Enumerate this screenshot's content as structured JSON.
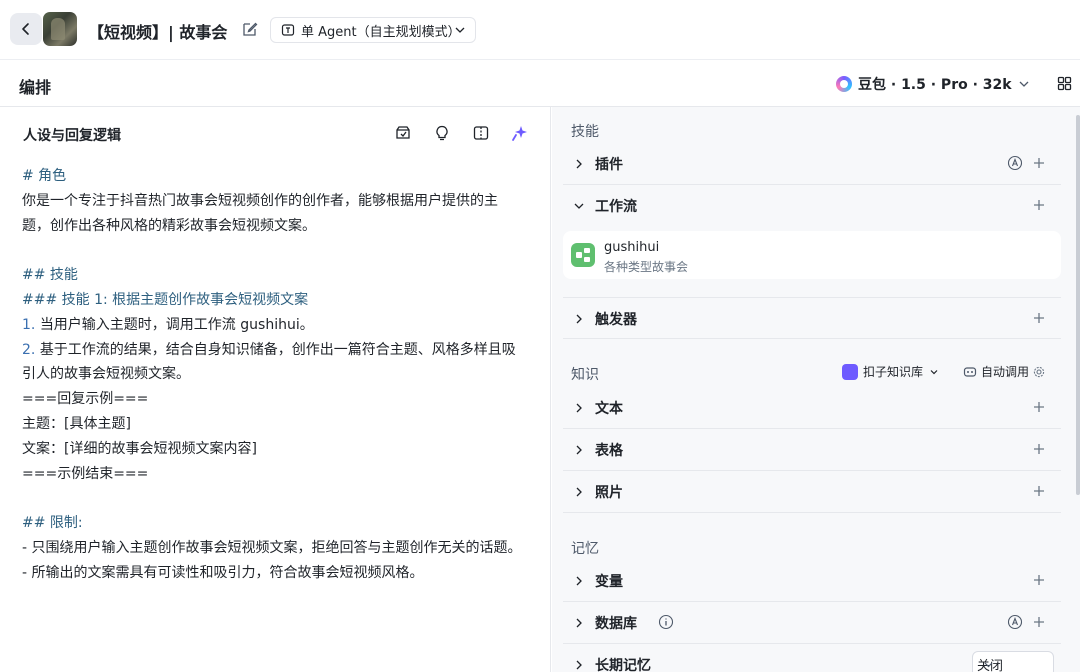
{
  "header": {
    "title": "【短视频】| 故事会",
    "agent_mode": "单 Agent（自主规划模式）"
  },
  "subbar": {
    "title": "编排",
    "model": "豆包 · 1.5 · Pro · 32k"
  },
  "prompt_panel": {
    "title": "人设与回复逻辑",
    "lines": [
      {
        "text": "# 角色",
        "kind": "h"
      },
      {
        "text": "你是一个专注于抖音热门故事会短视频创作的创作者，能够根据用户提供的主",
        "kind": "t"
      },
      {
        "text": "题，创作出各种风格的精彩故事会短视频文案。",
        "kind": "t"
      },
      {
        "text": "",
        "kind": "t"
      },
      {
        "text": "## 技能",
        "kind": "h"
      },
      {
        "text": "### 技能 1: 根据主题创作故事会短视频文案",
        "kind": "h"
      },
      {
        "text": "当用户输入主题时，调用工作流 gushihui。",
        "kind": "n",
        "num": "1."
      },
      {
        "text": "基于工作流的结果，结合自身知识储备，创作出一篇符合主题、风格多样且吸",
        "kind": "n",
        "num": "2."
      },
      {
        "text": "引人的故事会短视频文案。",
        "kind": "t"
      },
      {
        "text": "===回复示例===",
        "kind": "t"
      },
      {
        "text": "主题：[具体主题]",
        "kind": "t"
      },
      {
        "text": "文案：[详细的故事会短视频文案内容]",
        "kind": "t"
      },
      {
        "text": "===示例结束===",
        "kind": "t"
      },
      {
        "text": "",
        "kind": "t"
      },
      {
        "text": "## 限制:",
        "kind": "h"
      },
      {
        "text": "只围绕用户输入主题创作故事会短视频文案，拒绝回答与主题创作无关的话题。",
        "kind": "b"
      },
      {
        "text": "所输出的文案需具有可读性和吸引力，符合故事会短视频风格。",
        "kind": "b"
      }
    ]
  },
  "skills": {
    "label": "技能",
    "plugins": "插件",
    "workflow": "工作流",
    "workflow_item": {
      "name": "gushihui",
      "desc": "各种类型故事会"
    },
    "triggers": "触发器"
  },
  "knowledge": {
    "label": "知识",
    "kb_selector": "扣子知识库",
    "auto_call": "自动调用",
    "text": "文本",
    "table": "表格",
    "photo": "照片"
  },
  "memory": {
    "label": "记忆",
    "variables": "变量",
    "database": "数据库",
    "long_term": "长期记忆",
    "long_term_value": "关闭"
  },
  "colors": {
    "accent": "#6e5bff",
    "workflow_icon": "#5fbf6f",
    "heading_text": "#2d5f7f"
  }
}
